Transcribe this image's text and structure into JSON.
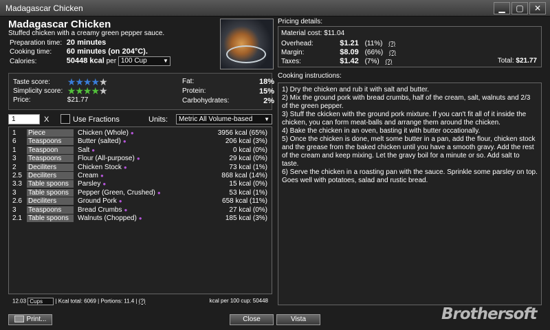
{
  "window": {
    "title": "Madagascar Chicken",
    "minimize": "▁",
    "maximize": "▢",
    "close": "✕"
  },
  "recipe": {
    "name": "Madagascar Chicken",
    "subtitle": "Stuffed chicken with a creamy green pepper sauce.",
    "prep_label": "Preparation time:",
    "prep_value": "20 minutes",
    "cook_label": "Cooking time:",
    "cook_value": "60 minutes (on 204°C).",
    "cal_label": "Calories:",
    "cal_value": "50448 kcal",
    "cal_per": "per",
    "cal_unit": "100 Cup"
  },
  "scores": {
    "taste_label": "Taste score:",
    "taste_stars": 4,
    "simplicity_label": "Simplicity score:",
    "simplicity_stars": 4,
    "price_label": "Price:",
    "price_value": "$21.77",
    "fat_label": "Fat:",
    "fat_value": "18%",
    "protein_label": "Protein:",
    "protein_value": "15%",
    "carbs_label": "Carbohydrates:",
    "carbs_value": "2%"
  },
  "quantity": {
    "value": "1",
    "x": "X",
    "fractions_label": "Use Fractions",
    "units_label": "Units:",
    "units_value": "Metric All Volume-based"
  },
  "ingredients": [
    {
      "amount": "1",
      "unit": "Piece",
      "name": "Chicken (Whole)",
      "kcal": "3956 kcal (65%)"
    },
    {
      "amount": "6",
      "unit": "Teaspoons",
      "name": "Butter (salted)",
      "kcal": "206 kcal (3%)"
    },
    {
      "amount": "1",
      "unit": "Teaspoon",
      "name": "Salt",
      "kcal": "0 kcal (0%)"
    },
    {
      "amount": "3",
      "unit": "Teaspoons",
      "name": "Flour (All-purpose)",
      "kcal": "29 kcal (0%)"
    },
    {
      "amount": "2",
      "unit": "Deciliters",
      "name": "Chicken Stock",
      "kcal": "73 kcal (1%)"
    },
    {
      "amount": "2.5",
      "unit": "Deciliters",
      "name": "Cream",
      "kcal": "868 kcal (14%)"
    },
    {
      "amount": "3.3",
      "unit": "Table spoons",
      "name": "Parsley",
      "kcal": "15 kcal (0%)"
    },
    {
      "amount": "3",
      "unit": "Table spoons",
      "name": "Pepper (Green, Crushed)",
      "kcal": "53 kcal (1%)"
    },
    {
      "amount": "2.6",
      "unit": "Deciliters",
      "name": "Ground Pork",
      "kcal": "658 kcal (11%)"
    },
    {
      "amount": "3",
      "unit": "Teaspoons",
      "name": "Bread Crumbs",
      "kcal": "27 kcal (0%)"
    },
    {
      "amount": "2.1",
      "unit": "Table spoons",
      "name": "Walnuts (Chopped)",
      "kcal": "185 kcal (3%)"
    }
  ],
  "footer": {
    "cups_value": "12.03",
    "cups_unit": "Cups",
    "kcal_total": "| Kcal total: 6069 | Portions: 11.4 |",
    "help": "(?)",
    "kcal_per": "kcal per 100 cup: 50448"
  },
  "pricing": {
    "title": "Pricing details:",
    "material_label": "Material cost:",
    "material_value": "$11.04",
    "overhead_label": "Overhead:",
    "overhead_value": "$1.21",
    "overhead_pct": "(11%)",
    "margin_label": "Margin:",
    "margin_value": "$8.09",
    "margin_pct": "(66%)",
    "taxes_label": "Taxes:",
    "taxes_value": "$1.42",
    "taxes_pct": "(7%)",
    "help": "(?)",
    "total_label": "Total:",
    "total_value": "$21.77"
  },
  "instructions": {
    "title": "Cooking instructions:",
    "steps": [
      "1) Dry the chicken and rub it with salt and butter.",
      "2) Mix the ground pork with bread crumbs, half of the cream, salt, walnuts and 2/3 of the green pepper.",
      "3) Stuff the ckicken with the ground pork mixture. If you can't fit all of it inside the chicken, you can form meat-balls and arrange them around the chicken.",
      "4) Bake the chicken in an oven, basting it with butter occationally.",
      "5) Once the chicken is done, melt some butter in a pan, add the flour, chicken stock and the grease from the baked chicken until you have a smooth gravy. Add the rest of the cream and keep mixing. Let the gravy boil for a minute or so. Add salt to taste.",
      "6) Serve the chicken in a roasting pan with the sauce. Sprinkle some parsley on top. Goes well with potatoes, salad and rustic bread."
    ]
  },
  "buttons": {
    "print": "Print...",
    "close": "Close",
    "vista": "Vista"
  },
  "brand": "Brothersoft",
  "colors": {
    "star_taste": "#3a7dd8",
    "star_simplicity": "#52c03b",
    "ingredient_dot": "#b455d8"
  }
}
